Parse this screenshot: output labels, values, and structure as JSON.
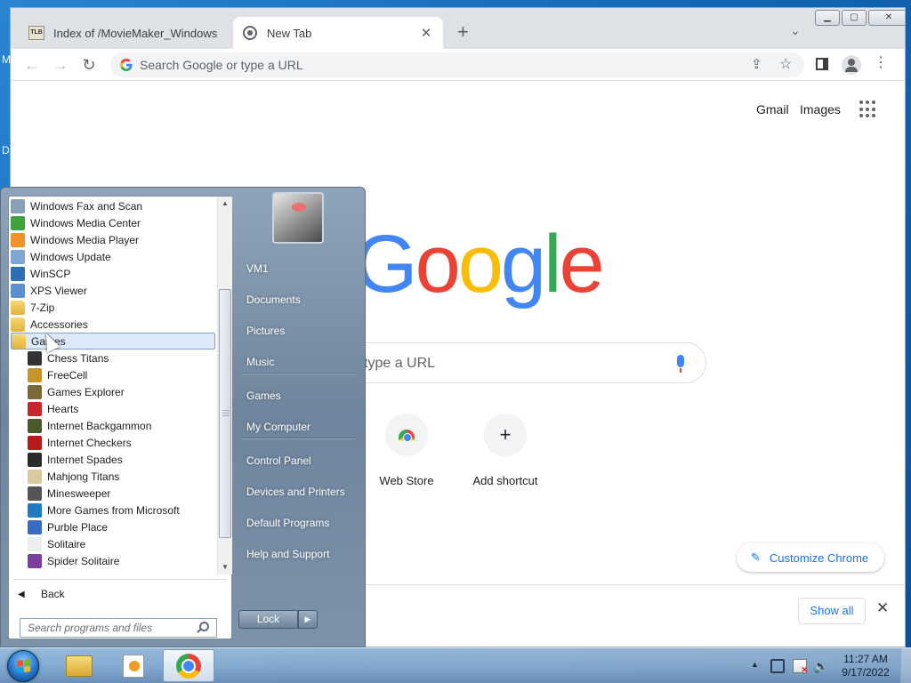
{
  "desktop": {
    "edge_letters": [
      "M",
      "D"
    ]
  },
  "chrome": {
    "tabs": [
      {
        "title": "Index of /MovieMaker_Windows",
        "favicon_text": "TLB",
        "state": "inactive"
      },
      {
        "title": "New Tab",
        "state": "active"
      }
    ],
    "omnibox_placeholder": "Search Google or type a URL",
    "ntp": {
      "top_links": [
        "Gmail",
        "Images"
      ],
      "logo_letters": [
        "G",
        "o",
        "o",
        "g",
        "l",
        "e"
      ],
      "search_placeholder": "type a URL",
      "shortcuts": [
        {
          "label": "Web Store",
          "icon": "webstore-icon"
        },
        {
          "label": "Add shortcut",
          "icon": "plus-icon",
          "glyph": "+"
        }
      ],
      "customize_label": "Customize Chrome"
    },
    "bottom_bar": {
      "show_all_label": "Show all",
      "close_glyph": "✕"
    },
    "colors": {
      "google_blue": "#4285f4",
      "google_red": "#ea4335",
      "google_yellow": "#fbbc05",
      "google_green": "#34a853",
      "link_blue": "#1a73e8"
    }
  },
  "startmenu": {
    "programs": [
      {
        "label": "Windows Fax and Scan",
        "icon": "fax-scan-icon",
        "indent": 0,
        "color": "#8aa0b8"
      },
      {
        "label": "Windows Media Center",
        "icon": "media-center-icon",
        "indent": 0,
        "color": "#3ea33e"
      },
      {
        "label": "Windows Media Player",
        "icon": "media-player-icon",
        "indent": 0,
        "color": "#f0912a"
      },
      {
        "label": "Windows Update",
        "icon": "windows-update-icon",
        "indent": 0,
        "color": "#7fa7d6"
      },
      {
        "label": "WinSCP",
        "icon": "winscp-icon",
        "indent": 0,
        "color": "#2f6db5"
      },
      {
        "label": "XPS Viewer",
        "icon": "xps-viewer-icon",
        "indent": 0,
        "color": "#5b8fd1"
      },
      {
        "label": "7-Zip",
        "icon": "folder-icon",
        "indent": 0,
        "folder": true
      },
      {
        "label": "Accessories",
        "icon": "folder-icon",
        "indent": 0,
        "folder": true
      },
      {
        "label": "Games",
        "icon": "folder-icon",
        "indent": 0,
        "folder": true,
        "selected": true
      },
      {
        "label": "Chess Titans",
        "icon": "chess-titans-icon",
        "indent": 1,
        "color": "#333333"
      },
      {
        "label": "FreeCell",
        "icon": "freecell-icon",
        "indent": 1,
        "color": "#c9952a"
      },
      {
        "label": "Games Explorer",
        "icon": "games-explorer-icon",
        "indent": 1,
        "color": "#7a6a3a"
      },
      {
        "label": "Hearts",
        "icon": "hearts-icon",
        "indent": 1,
        "color": "#c8262c"
      },
      {
        "label": "Internet Backgammon",
        "icon": "backgammon-icon",
        "indent": 1,
        "color": "#4a5a2a"
      },
      {
        "label": "Internet Checkers",
        "icon": "checkers-icon",
        "indent": 1,
        "color": "#b71c1c"
      },
      {
        "label": "Internet Spades",
        "icon": "spades-icon",
        "indent": 1,
        "color": "#2b2b2b"
      },
      {
        "label": "Mahjong Titans",
        "icon": "mahjong-icon",
        "indent": 1,
        "color": "#d8c9a0"
      },
      {
        "label": "Minesweeper",
        "icon": "minesweeper-icon",
        "indent": 1,
        "color": "#555555"
      },
      {
        "label": "More Games from Microsoft",
        "icon": "more-games-icon",
        "indent": 1,
        "color": "#1f7ac0"
      },
      {
        "label": "Purble Place",
        "icon": "purble-place-icon",
        "indent": 1,
        "color": "#3a6bc4"
      },
      {
        "label": "Solitaire",
        "icon": "solitaire-icon",
        "indent": 1,
        "color": "#eeeeee"
      },
      {
        "label": "Spider Solitaire",
        "icon": "spider-solitaire-icon",
        "indent": 1,
        "color": "#7b3fa0"
      }
    ],
    "back_label": "Back",
    "search_placeholder": "Search programs and files",
    "right_items": [
      "VM1",
      "Documents",
      "Pictures",
      "Music",
      "Games",
      "My Computer",
      "Control Panel",
      "Devices and Printers",
      "Default Programs",
      "Help and Support"
    ],
    "lock_label": "Lock"
  },
  "taskbar": {
    "apps": [
      {
        "name": "Windows Explorer",
        "icon": "explorer-icon"
      },
      {
        "name": "Windows Movie Maker",
        "icon": "movie-maker-icon"
      },
      {
        "name": "Google Chrome",
        "icon": "chrome-icon",
        "active": true
      }
    ],
    "clock_time": "11:27 AM",
    "clock_date": "9/17/2022"
  }
}
